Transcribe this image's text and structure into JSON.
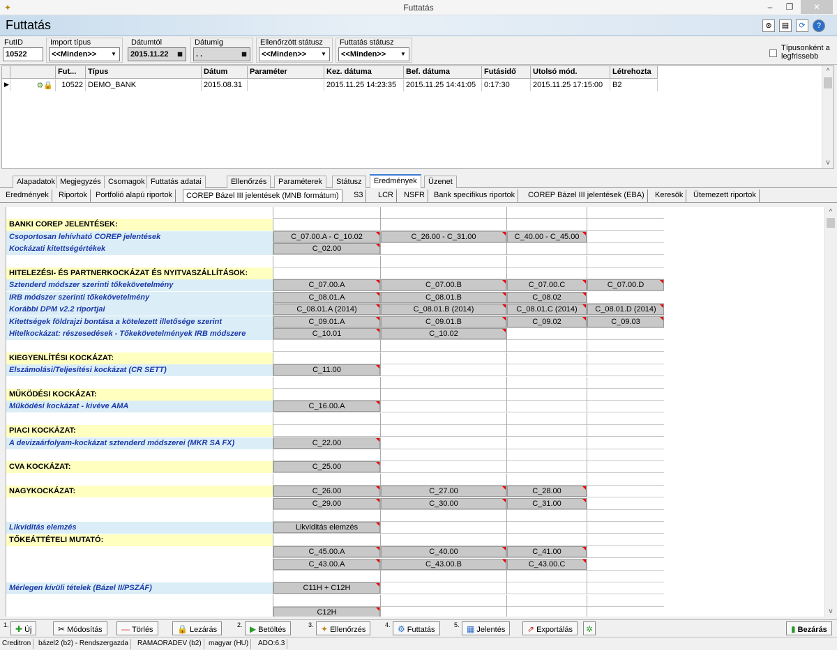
{
  "window": {
    "title": "Futtatás"
  },
  "page": {
    "title": "Futtatás"
  },
  "filters": {
    "futid_label": "FutID",
    "futid_value": "10522",
    "import_label": "Import típus",
    "import_value": "<<Minden>>",
    "datumtol_label": "Dátumtól",
    "datumtol_value": "2015.11.22",
    "datumig_label": "Dátumig",
    "datumig_value": ". .",
    "ellenorzott_label": "Ellenőrzött státusz",
    "ellenorzott_value": "<<Minden>>",
    "futtatas_status_label": "Futtatás státusz",
    "futtatas_status_value": "<<Minden>>",
    "tipusonkent_label_1": "Típusonként a",
    "tipusonkent_label_2": "legfrissebb"
  },
  "grid": {
    "headers": [
      "Fut...",
      "Típus",
      "Dátum",
      "Paraméter",
      "Kez. dátuma",
      "Bef. dátuma",
      "Futásidő",
      "Utolsó mód.",
      "Létrehozta"
    ],
    "row": {
      "fut": "10522",
      "tipus": "DEMO_BANK",
      "datum": "2015.08.31",
      "parameter": "",
      "kez": "2015.11.25 14:23:35",
      "bef": "2015.11.25 14:41:05",
      "futasido": "0:17:30",
      "utolso": "2015.11.25 17:15:00",
      "letrehozta": "B2"
    }
  },
  "tabs1": [
    "Alapadatok",
    "Megjegyzés",
    "Csomagok",
    "Futtatás adatai",
    "Ellenőrzés",
    "Paraméterek",
    "Státusz",
    "Eredmények",
    "Üzenet"
  ],
  "tabs2": [
    "Eredmények",
    "Riportok",
    "Portfolió alapú riportok",
    "COREP Bázel III jelentések (MNB formátum)",
    "S3",
    "LCR",
    "NSFR",
    "Bank specifikus riportok",
    "COREP Bázel III jelentések (EBA)",
    "Keresök",
    "Ütemezett riportok"
  ],
  "report": {
    "r0": "",
    "r1": "BANKI COREP JELENTÉSEK:",
    "r2": "Csoportosan lehívható COREP jelentések",
    "r2b": [
      "C_07.00.A - C_10.02",
      "C_26.00 - C_31.00",
      "C_40.00 - C_45.00"
    ],
    "r3": "Kockázati kitettségértékek",
    "r3b": [
      "C_02.00"
    ],
    "r5": "HITELEZÉSI- ÉS PARTNERKOCKÁZAT ÉS NYITVASZÁLLÍTÁSOK:",
    "r6": "Sztenderd módszer szerinti tőkekövetelmény",
    "r6b": [
      "C_07.00.A",
      "C_07.00.B",
      "C_07.00.C",
      "C_07.00.D"
    ],
    "r7": "IRB módszer szerinti tőkekövetelmény",
    "r7b": [
      "C_08.01.A",
      "C_08.01.B",
      "C_08.02"
    ],
    "r8": "Korábbi DPM v2.2 riportjai",
    "r8b": [
      "C_08.01.A (2014)",
      "C_08.01.B (2014)",
      "C_08.01.C (2014)",
      "C_08.01.D (2014)"
    ],
    "r9": "Kitettségek földrajzi bontása a kötelezett illetősége szerint",
    "r9b": [
      "C_09.01.A",
      "C_09.01.B",
      "C_09.02",
      "C_09.03"
    ],
    "r10": "Hitelkockázat: részesedések - Tőkekövetelmények IRB módszere",
    "r10b": [
      "C_10.01",
      "C_10.02"
    ],
    "r12": "KIEGYENLÍTÉSI KOCKÁZAT:",
    "r13": "Elszámolási/Teljesítési kockázat (CR SETT)",
    "r13b": [
      "C_11.00"
    ],
    "r15": "MŰKÖDÉSI KOCKÁZAT:",
    "r16": "Működési kockázat - kivéve AMA",
    "r16b": [
      "C_16.00.A"
    ],
    "r18": "PIACI KOCKÁZAT:",
    "r19": "A devizaárfolyam-kockázat sztenderd módszerei (MKR SA FX)",
    "r19b": [
      "C_22.00"
    ],
    "r21": "CVA KOCKÁZAT:",
    "r21b": [
      "C_25.00"
    ],
    "r23": "NAGYKOCKÁZAT:",
    "r23b": [
      "C_26.00",
      "C_27.00",
      "C_28.00"
    ],
    "r24b": [
      "C_29.00",
      "C_30.00",
      "C_31.00"
    ],
    "r26": "Likviditás elemzés",
    "r26b": [
      "Likviditás elemzés"
    ],
    "r27": "TŐKEÁTTÉTELI MUTATÓ:",
    "r28b": [
      "C_45.00.A",
      "C_40.00",
      "C_41.00"
    ],
    "r29b": [
      "C_43.00.A",
      "C_43.00.B",
      "C_43.00.C"
    ],
    "r31": "Mérlegen kívüli tételek (Bázel II/PSZÁF)",
    "r31b": [
      "C11H + C12H"
    ],
    "r33b": [
      "C12H"
    ]
  },
  "toolbar": {
    "n1": "1.",
    "uj": "Új",
    "modositas": "Módosítás",
    "torles": "Törlés",
    "lezaras": "Lezárás",
    "n2": "2.",
    "betoltes": "Betöltés",
    "n3": "3.",
    "ellenorzes": "Ellenőrzés",
    "n4": "4.",
    "futtatas": "Futtatás",
    "n5": "5.",
    "jelentes": "Jelentés",
    "exportalas": "Exportálás",
    "bezaras": "Bezárás"
  },
  "status": [
    "Creditron",
    "bázel2 (b2) - Rendszergazda",
    "RAMAORADEV (b2)",
    "magyar (HU)",
    "ADO:6.3"
  ]
}
